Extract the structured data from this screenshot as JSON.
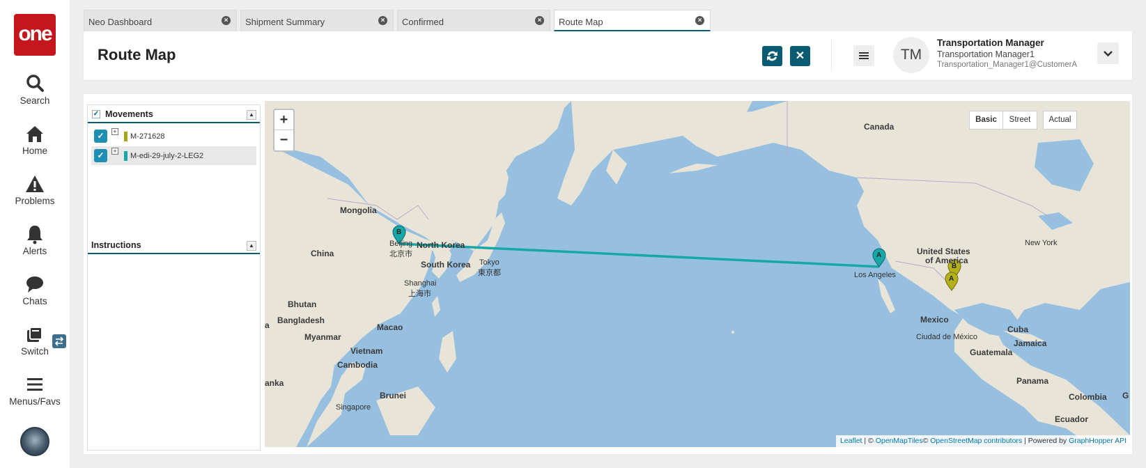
{
  "app": {
    "logo_text": "one",
    "brand_color": "#c4161c",
    "accent_color": "#0b5c73"
  },
  "nav": {
    "items": [
      {
        "label": "Search",
        "icon": "search-icon"
      },
      {
        "label": "Home",
        "icon": "home-icon"
      },
      {
        "label": "Problems",
        "icon": "warning-icon"
      },
      {
        "label": "Alerts",
        "icon": "bell-icon"
      },
      {
        "label": "Chats",
        "icon": "chat-icon"
      },
      {
        "label": "Switch",
        "icon": "switch-icon"
      },
      {
        "label": "Menus/Favs",
        "icon": "hamburger-icon"
      }
    ]
  },
  "tabs": [
    {
      "label": "Neo Dashboard"
    },
    {
      "label": "Shipment Summary"
    },
    {
      "label": "Confirmed"
    },
    {
      "label": "Route Map"
    }
  ],
  "header": {
    "title": "Route Map"
  },
  "user": {
    "initials": "TM",
    "name": "Transportation Manager",
    "role": "Transportation Manager1",
    "email": "Transportation_Manager1@CustomerA"
  },
  "movements": {
    "title": "Movements",
    "items": [
      {
        "label": "M-271628",
        "color": "#a8a614",
        "checked": true
      },
      {
        "label": "M-edi-29-july-2-LEG2",
        "color": "#17a7a7",
        "checked": true
      }
    ]
  },
  "instructions": {
    "title": "Instructions"
  },
  "map": {
    "zoom_in": "+",
    "zoom_out": "−",
    "layers": [
      "Basic",
      "Street",
      "Actual"
    ],
    "active_layer": "Basic",
    "labels": {
      "canada": "Canada",
      "mongolia": "Mongolia",
      "china": "China",
      "north_korea": "North Korea",
      "south_korea": "South Korea",
      "beijing": "Beijing",
      "beijing_cn": "北京市",
      "tokyo": "Tokyo",
      "tokyo_jp": "東京都",
      "shanghai": "Shanghai",
      "shanghai_cn": "上海市",
      "bhutan": "Bhutan",
      "bangladesh": "Bangladesh",
      "macao": "Macao",
      "myanmar": "Myanmar",
      "vietnam": "Vietnam",
      "cambodia": "Cambodia",
      "brunei": "Brunei",
      "singapore": "Singapore",
      "sri_lanka": "anka",
      "left_edge_a": "a",
      "los_angeles": "Los Angeles",
      "usa_1": "United States",
      "usa_2": "of America",
      "new_york": "New York",
      "mexico": "Mexico",
      "mexico_city": "Ciudad de México",
      "cuba": "Cuba",
      "jamaica": "Jamaica",
      "guatemala": "Guatemala",
      "panama": "Panama",
      "colombia": "Colombia",
      "ecuador": "Ecuador",
      "right_edge_g": "G"
    },
    "markers": {
      "teal_a": "A",
      "teal_b": "B",
      "olive_a": "A",
      "olive_b": "B"
    },
    "attribution": {
      "leaflet": "Leaflet",
      "sep1": " | © ",
      "omt": "OpenMapTiles",
      "copy": "© ",
      "osm": "OpenStreetMap contributors",
      "powered": " | Powered by ",
      "gh": "GraphHopper API"
    }
  }
}
